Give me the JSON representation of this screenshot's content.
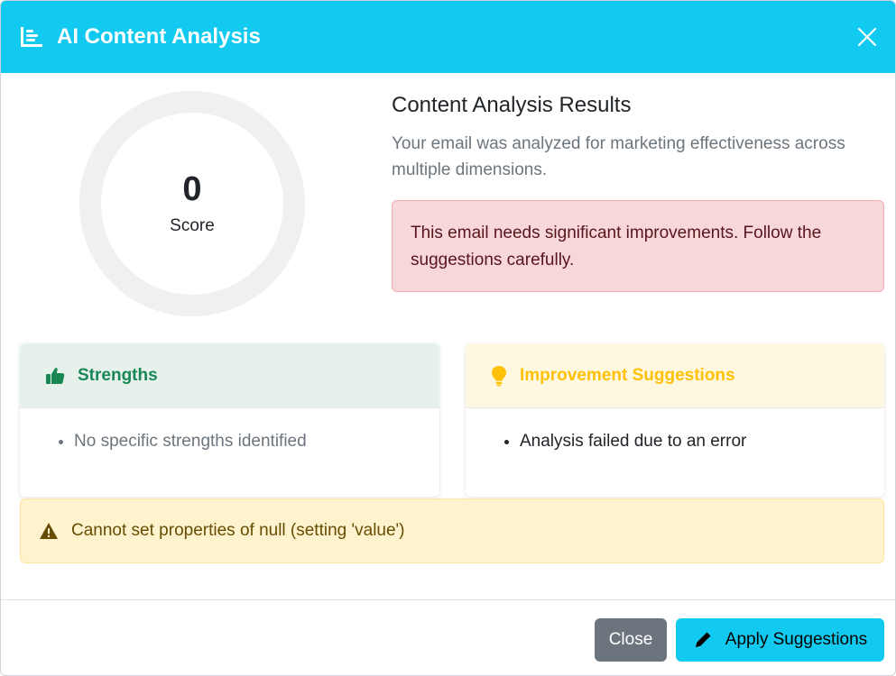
{
  "header": {
    "title": "AI Content Analysis",
    "icon": "chart-bar-icon",
    "close_icon": "close-icon",
    "background": "#12caf0"
  },
  "score": {
    "value": "0",
    "label": "Score"
  },
  "results": {
    "title": "Content Analysis Results",
    "description": "Your email was analyzed for marketing effectiveness across multiple dimensions.",
    "alert": "This email needs significant improvements. Follow the suggestions carefully."
  },
  "strengths": {
    "title": "Strengths",
    "icon": "thumbs-up-icon",
    "items": [
      "No specific strengths identified"
    ]
  },
  "improvements": {
    "title": "Improvement Suggestions",
    "icon": "lightbulb-icon",
    "items": [
      "Analysis failed due to an error"
    ]
  },
  "error": {
    "icon": "warning-triangle-icon",
    "message": "Cannot set properties of null (setting 'value')"
  },
  "footer": {
    "close_label": "Close",
    "apply_label": "Apply Suggestions",
    "apply_icon": "pencil-icon"
  },
  "colors": {
    "accent": "#12caf0",
    "success": "#198754",
    "warning": "#ffc107",
    "danger_bg": "#f8d7da",
    "warning_bg": "#fff3cd"
  }
}
